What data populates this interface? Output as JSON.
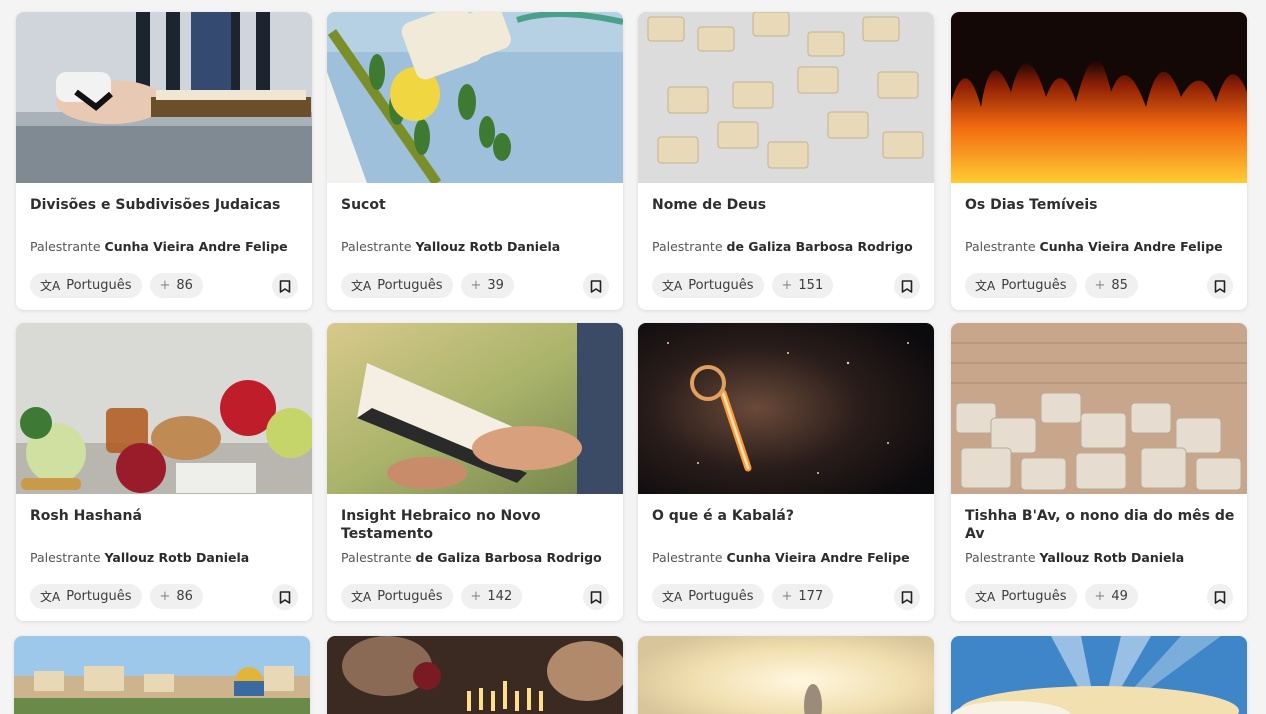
{
  "labels": {
    "speaker_prefix": "Palestrante",
    "language_icon": "translate-icon",
    "plus_icon": "plus-icon",
    "bookmark_icon": "bookmark-icon"
  },
  "cards": [
    {
      "title": "Divisões e Subdivisões Judaicas",
      "speaker": "Cunha Vieira Andre Felipe",
      "language": "Português",
      "count": "86",
      "image": "man-reading-book-tallit"
    },
    {
      "title": "Sucot",
      "speaker": "Yallouz Rotb Daniela",
      "language": "Português",
      "count": "39",
      "image": "etrog-lulav-scroll"
    },
    {
      "title": "Nome de Deus",
      "speaker": "de Galiza Barbosa Rodrigo",
      "language": "Português",
      "count": "151",
      "image": "hebrew-letter-tiles"
    },
    {
      "title": "Os Dias Temíveis",
      "speaker": "Cunha Vieira Andre Felipe",
      "language": "Português",
      "count": "85",
      "image": "fire-flames"
    },
    {
      "title": "Rosh Hashaná",
      "speaker": "Yallouz Rotb Daniela",
      "language": "Português",
      "count": "86",
      "image": "apples-honey-pomegranate"
    },
    {
      "title": "Insight Hebraico no Novo Testamento",
      "speaker": "de Galiza Barbosa Rodrigo",
      "language": "Português",
      "count": "142",
      "image": "hands-holding-bible"
    },
    {
      "title": "O que é a Kabalá?",
      "speaker": "Cunha Vieira Andre Felipe",
      "language": "Português",
      "count": "177",
      "image": "glowing-key-space"
    },
    {
      "title": "Tishha B'Av, o nono dia do mês de Av",
      "speaker": "Yallouz Rotb Daniela",
      "language": "Português",
      "count": "49",
      "image": "ruined-stone-wall"
    }
  ],
  "partial_cards": [
    {
      "image": "jerusalem-skyline"
    },
    {
      "image": "menorah-candles-dinner"
    },
    {
      "image": "sunlight-figure"
    },
    {
      "image": "sunrays-clouds"
    }
  ],
  "colors": {
    "card_bg": "#ffffff",
    "page_bg": "#f4f4f5",
    "chip_bg": "#f0f0f1"
  }
}
